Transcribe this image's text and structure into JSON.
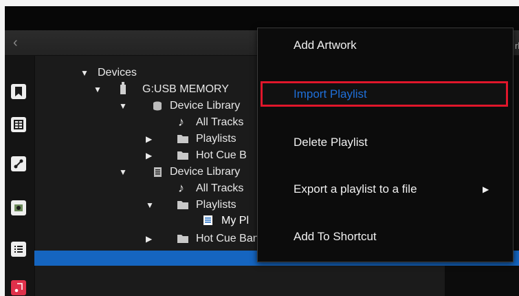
{
  "tree": {
    "devices": "Devices",
    "usb": "G:USB MEMORY",
    "library1": "Device Library",
    "all_tracks_1": "All Tracks",
    "playlists_1": "Playlists",
    "hot_cue_1": "Hot Cue B",
    "library2": "Device Library",
    "all_tracks_2": "All Tracks",
    "playlists_2": "Playlists",
    "my_playlist": "My Pl",
    "hot_cue_2": "Hot Cue Bank Lists"
  },
  "menu": {
    "items": [
      {
        "label": "Add Artwork"
      },
      {
        "label": "Import Playlist"
      },
      {
        "label": "Delete Playlist"
      },
      {
        "label": "Export a playlist to a file"
      },
      {
        "label": "Add To Shortcut"
      }
    ]
  },
  "right_tail": "rl",
  "colors": {
    "selection": "#1565c0",
    "highlight_border": "#e0162b",
    "highlight_text": "#1f6fd8"
  }
}
